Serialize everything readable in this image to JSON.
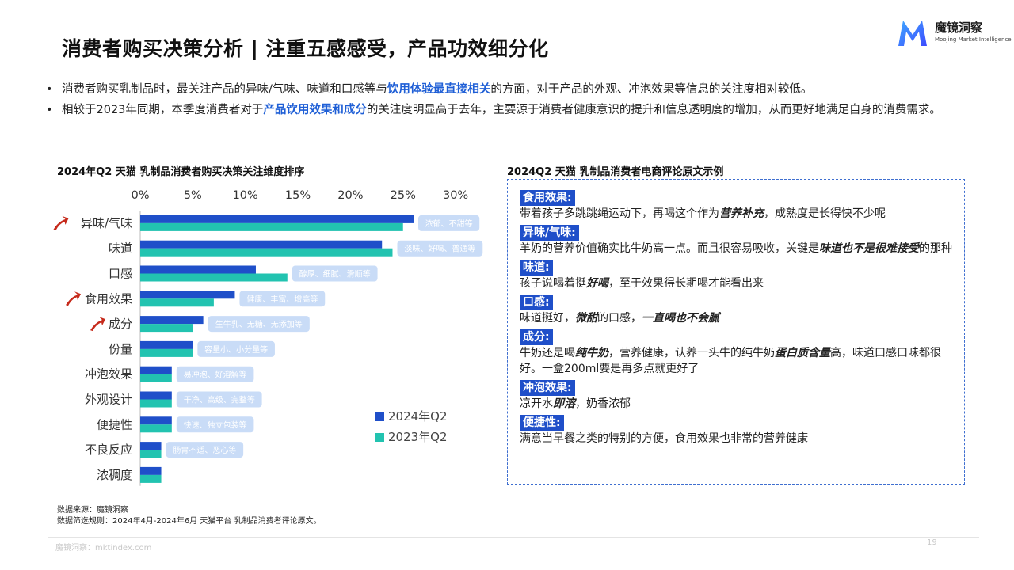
{
  "header": {
    "title": "消费者购买决策分析 | 注重五感感受，产品功效细分化",
    "logo_name": "魔镜洞察",
    "logo_sub": "Moojing Market Intelligence"
  },
  "bullets": [
    {
      "pre": "消费者购买乳制品时，最关注产品的异味/气味、味道和口感等与",
      "hl": "饮用体验最直接相关",
      "post": "的方面，对于产品的外观、冲泡效果等信息的关注度相对较低。"
    },
    {
      "pre": "相较于2023年同期，本季度消费者对于",
      "hl": "产品饮用效果和成分",
      "post": "的关注度明显高于去年，主要源于消费者健康意识的提升和信息透明度的增加，从而更好地满足自身的消费需求。"
    }
  ],
  "bullet_mark": "•",
  "left_title": "2024年Q2 天猫 乳制品消费者购买决策关注维度排序",
  "right_title": "2024Q2 天猫 乳制品消费者电商评论原文示例",
  "chart_data": {
    "type": "bar",
    "orientation": "horizontal",
    "categories": [
      "异味/气味",
      "味道",
      "口感",
      "食用效果",
      "成分",
      "份量",
      "冲泡效果",
      "外观设计",
      "便捷性",
      "不良反应",
      "浓稠度"
    ],
    "series": [
      {
        "name": "2024年Q2",
        "color": "#1f4fc9",
        "values": [
          26.0,
          23.0,
          11.0,
          9.0,
          6.0,
          5.0,
          3.0,
          3.0,
          3.0,
          2.0,
          2.0
        ]
      },
      {
        "name": "2023年Q2",
        "color": "#22c3b0",
        "values": [
          25.0,
          24.0,
          14.0,
          7.0,
          5.0,
          5.0,
          3.0,
          3.0,
          3.0,
          2.0,
          2.0
        ]
      }
    ],
    "xticks": [
      "0%",
      "5%",
      "10%",
      "15%",
      "20%",
      "25%",
      "30%"
    ],
    "xlim": [
      0,
      30
    ],
    "keywords": [
      "浓郁、不甜等",
      "淡味、好喝、普通等",
      "醇厚、细腻、滑顺等",
      "健康、丰富、增高等",
      "生牛乳、无糖、无添加等",
      "容量小、小分量等",
      "易冲泡、好溶解等",
      "干净、高级、完整等",
      "快速、独立包装等",
      "肠胃不适、恶心等",
      ""
    ],
    "highlighted": [
      "异味/气味",
      "食用效果",
      "成分"
    ],
    "highlight_color": "#c62a1b",
    "keyword_bg": "#c9dcf7"
  },
  "reviews": [
    {
      "tag": "食用效果:",
      "parts": [
        {
          "t": "带着孩子多跳跳绳运动下，再喝这个作为"
        },
        {
          "t": "营养补充",
          "b": true
        },
        {
          "t": "，成熟度是长得快不少呢"
        }
      ]
    },
    {
      "tag": "异味/气味:",
      "parts": [
        {
          "t": "羊奶的营养价值确实比牛奶高一点。而且很容易吸收，关键是"
        },
        {
          "t": "味道也不是很难接受",
          "b": true
        },
        {
          "t": "的那种"
        }
      ]
    },
    {
      "tag": "味道:",
      "parts": [
        {
          "t": "孩子说喝着挺"
        },
        {
          "t": "好喝",
          "b": true
        },
        {
          "t": "，至于效果得长期喝才能看出来"
        }
      ]
    },
    {
      "tag": "口感:",
      "parts": [
        {
          "t": "味道挺好，"
        },
        {
          "t": "微甜",
          "b": true
        },
        {
          "t": "的口感，"
        },
        {
          "t": "一直喝也不会腻",
          "b": true
        }
      ]
    },
    {
      "tag": "成分:",
      "parts": [
        {
          "t": "牛奶还是喝"
        },
        {
          "t": "纯牛奶",
          "b": true
        },
        {
          "t": "，营养健康，认养一头牛的纯牛奶"
        },
        {
          "t": "蛋白质含量",
          "b": true
        },
        {
          "t": "高，味道口感口味都很好。一盒200ml要是再多点就更好了"
        }
      ]
    },
    {
      "tag": "冲泡效果:",
      "parts": [
        {
          "t": "凉开水"
        },
        {
          "t": "即溶",
          "b": true
        },
        {
          "t": "，奶香浓郁"
        }
      ]
    },
    {
      "tag": "便捷性:",
      "parts": [
        {
          "t": "满意当早餐之类的特别的方便，食用效果也非常的营养健康"
        }
      ]
    }
  ],
  "source": {
    "line1": "数据来源：魔镜洞察",
    "line2": "数据筛选规则：2024年4月-2024年6月 天猫平台 乳制品消费者评论原文。"
  },
  "footer": {
    "left": "魔镜洞察：mktindex.com",
    "page": "19"
  }
}
